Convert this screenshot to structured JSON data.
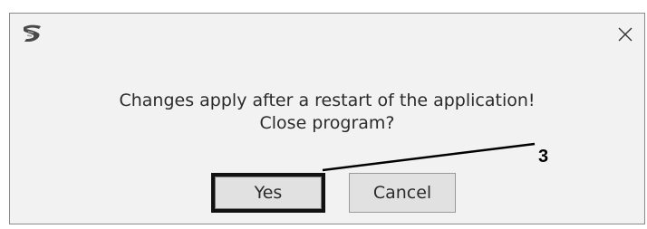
{
  "dialog": {
    "icon": "app-logo-icon",
    "close_icon": "close-icon",
    "message_line1": "Changes apply after a restart of the application!",
    "message_line2": "Close program?",
    "buttons": {
      "yes_label": "Yes",
      "cancel_label": "Cancel"
    }
  },
  "callout": {
    "number": "3"
  },
  "colors": {
    "dialog_background": "#f2f2f2",
    "button_background": "#e1e1e1",
    "highlight_border": "#111111",
    "text": "#2b2b2b"
  }
}
